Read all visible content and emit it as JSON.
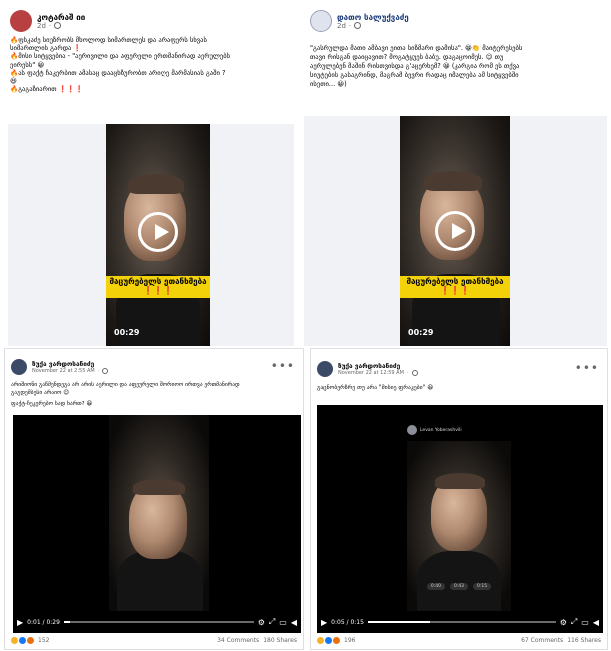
{
  "posts": [
    {
      "author": "კოტარაშ იი",
      "time": "2d",
      "lines": [
        "🔥ფსკაძე სიუზრობს მხოლოდ სიმართლეს და არაფერს სხვას",
        "სიმართლის გარდა ❗",
        "🔥მისი სიტყვებია - \"აერივილი და აფერელი ერთმანირად აერულებს",
        "ეირესს\" 😀",
        "🔥ას ფაქტ ჩაკერბით ამასაც დააცხზურობთ არიღე მარმასიას გაში ?",
        "😆",
        "🔥გაგაზიარით ❗❗❗"
      ],
      "video": {
        "banner": "მაცურებელს ეთანხმება ❗❗❗",
        "duration": "00:29"
      }
    },
    {
      "author": "დათო სალუქვაძე",
      "time": "2d",
      "lines": [
        "\"გასრულდა მათი ამბავი ეითა სიზმარი დამისა\". 😁👏 მაიტერესებს",
        "თავი რისგან დაიცავით? მოგატყუეს ბაბუ. დაგაცოიმეს. 😉 თუ",
        "აერულებენ მაშინ რისთვისდა გ'აცერხემ? 😀 (კარგია რომ ეს თქვა",
        "სიუტების გასაგრინდ, მაგრამ ბევრი რადაც იმალება ამ სიტყვებში",
        "ისეთი... 😀)"
      ],
      "video": {
        "banner": "მაცურებელს ეთანხმება ❗❗❗",
        "duration": "00:29"
      }
    },
    {
      "author": "ზუქა ვარდოსანიძე",
      "time": "November 22 at 2:55 AM",
      "lines": [
        "არიშიონი გაწმენდეგა არ არის აერილი და აფეურელი შორიოო ირთვა ერთმანირად",
        "გაგდემბესი არაიო 😉",
        "ფაქტ-ჩეკერებო სად ხართ? 😆"
      ],
      "video": {
        "time": "0:01 / 0:29",
        "progress": 0.03
      },
      "reactions": {
        "count": "152",
        "comments": "34 Comments",
        "shares": "180 Shares"
      }
    },
    {
      "author": "ზუქა ვარდოსანიძე",
      "time": "November 22 at 12:59 AM",
      "lines": [
        "გაცნობერზრე თუ არა \"მისიე ფრაკები\" 😆"
      ],
      "video": {
        "time": "0:05 / 0:15",
        "progress": 0.33,
        "overlay_name": "Levan Yoberashvili",
        "overlay_stats": [
          "0:40",
          "0:43",
          "0:15"
        ]
      },
      "reactions": {
        "count": "196",
        "comments": "67 Comments",
        "shares": "116 Shares"
      }
    }
  ],
  "colors": {
    "banner": "#f4d20a",
    "text": "#050505",
    "muted": "#65676b",
    "like": "#1877f2",
    "haha": "#f7b125",
    "angry": "#e9710f"
  }
}
